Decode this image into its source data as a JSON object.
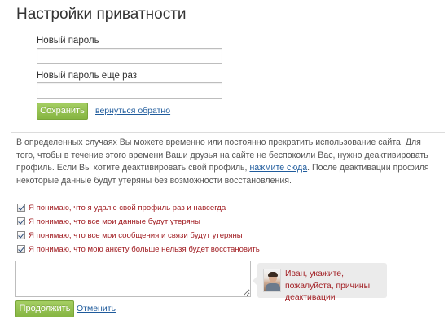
{
  "page": {
    "title": "Настройки приватности"
  },
  "password_form": {
    "new_password_label": "Новый пароль",
    "new_password_value": "",
    "repeat_password_label": "Новый пароль еще раз",
    "repeat_password_value": "",
    "save_label": "Сохранить",
    "back_link_label": "вернуться обратно"
  },
  "deactivation": {
    "info_part1": "В определенных случаях Вы можете временно или постоянно прекратить использование сайта. Для того, чтобы в течение этого времени Ваши друзья на сайте не беспокоили Вас, нужно деактивировать профиль. Если Вы хотите деактивировать свой профиль, ",
    "info_link": "нажмите сюда",
    "info_part2": ". После деактивации профиля некоторые данные будут утеряны без возможности восстановления.",
    "checkboxes": [
      {
        "label": "Я понимаю, что я удалю свой профиль раз и навсегда",
        "checked": true
      },
      {
        "label": "Я понимаю, что все мои данные будут утеряны",
        "checked": true
      },
      {
        "label": "Я понимаю, что все мои сообщения и связи будут утеряны",
        "checked": true
      },
      {
        "label": "Я понимаю, что мою анкету больше нельзя будет восстановить",
        "checked": true
      }
    ],
    "reason_value": "",
    "hint_text": "Иван, укажите, пожалуйста, причины деактивации",
    "continue_label": "Продолжить",
    "cancel_label": "Отменить"
  },
  "colors": {
    "accent_green": "#8dbb48",
    "link_blue": "#1f5b9c",
    "warning_red": "#a11d22"
  }
}
